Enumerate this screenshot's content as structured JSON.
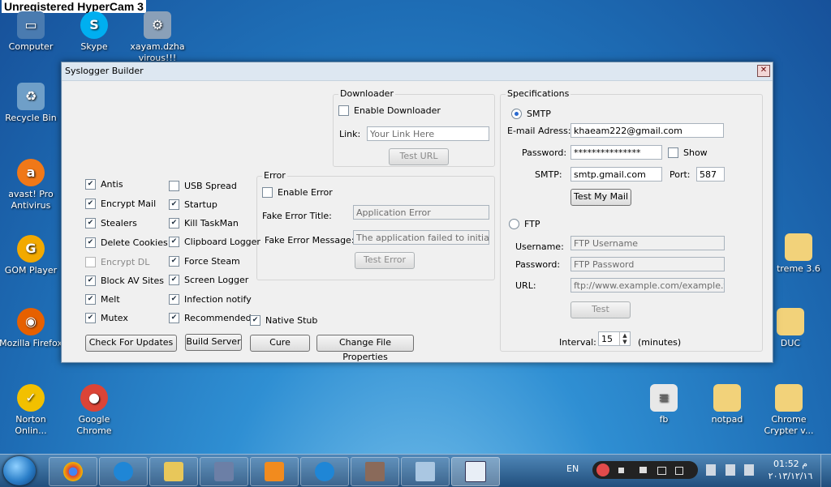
{
  "watermark": "Unregistered HyperCam 3",
  "desktop_icons": [
    {
      "label": "Computer",
      "color": "#4a7bb0"
    },
    {
      "label": "Skype",
      "color": "#00aff0"
    },
    {
      "label": "xayam.dzha virous!!!",
      "color": "#8aa0b8"
    },
    {
      "label": "Recycle Bin",
      "color": "#6f9fc8"
    },
    {
      "label": "avast! Pro Antivirus",
      "color": "#f07818"
    },
    {
      "label": "GOM Player",
      "color": "#f2a900"
    },
    {
      "label": "Mozilla Firefox",
      "color": "#e66000"
    },
    {
      "label": "Norton Onlin...",
      "color": "#f2c000"
    },
    {
      "label": "Google Chrome",
      "color": "#db4437"
    },
    {
      "label": "fb",
      "color": "#e8e8e8"
    },
    {
      "label": "notpad",
      "color": "#f2d27a"
    },
    {
      "label": "Chrome Crypter v...",
      "color": "#f2d27a"
    },
    {
      "label": "treme 3.6",
      "color": "#f2d27a"
    },
    {
      "label": "DUC",
      "color": "#f2d27a"
    }
  ],
  "window": {
    "title": "Syslogger Builder",
    "close_glyph": "✕",
    "checkboxes_left": [
      {
        "label": "Antis",
        "checked": true,
        "disabled": false
      },
      {
        "label": "Encrypt Mail",
        "checked": true,
        "disabled": false
      },
      {
        "label": "Stealers",
        "checked": true,
        "disabled": false
      },
      {
        "label": "Delete Cookies",
        "checked": true,
        "disabled": false
      },
      {
        "label": "Encrypt DL",
        "checked": false,
        "disabled": true
      },
      {
        "label": "Block AV Sites",
        "checked": true,
        "disabled": false
      },
      {
        "label": "Melt",
        "checked": true,
        "disabled": false
      },
      {
        "label": "Mutex",
        "checked": true,
        "disabled": false
      }
    ],
    "checkboxes_mid": [
      {
        "label": "USB Spread",
        "checked": false
      },
      {
        "label": "Startup",
        "checked": true
      },
      {
        "label": "Kill TaskMan",
        "checked": true
      },
      {
        "label": "Clipboard Logger",
        "checked": true
      },
      {
        "label": "Force Steam",
        "checked": true
      },
      {
        "label": "Screen Logger",
        "checked": true
      },
      {
        "label": "Infection notify",
        "checked": true
      },
      {
        "label": "Recommended",
        "checked": true
      }
    ],
    "native_stub": {
      "label": "Native Stub",
      "checked": true
    },
    "check_mark": "✔",
    "buttons": {
      "check_updates": "Check For Updates",
      "build_server": "Build Server",
      "cure": "Cure",
      "change_props": "Change File Properties"
    },
    "downloader": {
      "title": "Downloader",
      "enable_label": "Enable Downloader",
      "link_label": "Link:",
      "link_placeholder": "Your Link Here",
      "test_button": "Test URL"
    },
    "error": {
      "title": "Error",
      "enable_label": "Enable Error",
      "fake_title_label": "Fake Error Title:",
      "fake_title_value": "Application Error",
      "fake_message_label": "Fake Error Message:",
      "fake_message_value": "The application failed to initialize p",
      "test_button": "Test Error"
    },
    "specs": {
      "title": "Specifications",
      "smtp_radio": "SMTP",
      "email_label": "E-mail Adress:",
      "email_value": "khaeam222@gmail.com",
      "password_label": "Password:",
      "password_value": "***************",
      "show_label": "Show",
      "smtp_label": "SMTP:",
      "smtp_value": "smtp.gmail.com",
      "port_label": "Port:",
      "port_value": "587",
      "test_mail_button": "Test My Mail",
      "ftp_radio": "FTP",
      "ftp_user_label": "Username:",
      "ftp_user_value": "FTP Username",
      "ftp_pass_label": "Password:",
      "ftp_pass_value": "FTP Password",
      "url_label": "URL:",
      "url_value": "ftp://www.example.com/example.txt",
      "test_button": "Test",
      "interval_label": "Interval:",
      "interval_value": "15",
      "interval_unit": "(minutes)"
    }
  },
  "taskbar": {
    "lang": "EN",
    "time": "01:52",
    "ampm": "م",
    "date": "٢٠١٣/١٢/١٦"
  }
}
